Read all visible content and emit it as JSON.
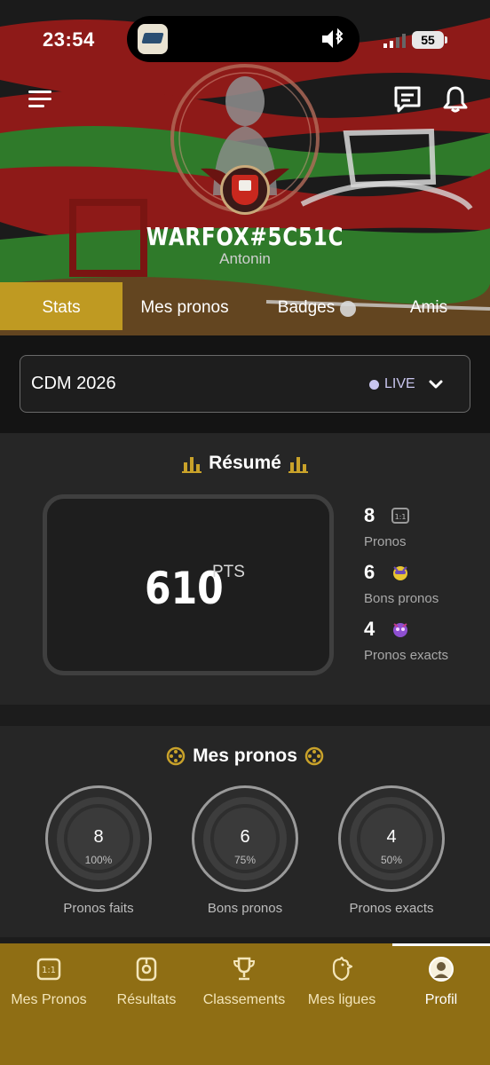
{
  "status_bar": {
    "time": "23:54",
    "battery": "55"
  },
  "profile": {
    "username": "WARFOX#5C51C",
    "real_name": "Antonin"
  },
  "tabs": [
    {
      "label": "Stats",
      "active": true
    },
    {
      "label": "Mes pronos",
      "active": false
    },
    {
      "label": "Badges",
      "active": false
    },
    {
      "label": "Amis",
      "active": false
    }
  ],
  "competition": {
    "name": "CDM 2026",
    "status": "LIVE"
  },
  "resume": {
    "title": "Résumé",
    "points": "610",
    "points_unit": "PTS",
    "stats": [
      {
        "value": "8",
        "label": "Pronos",
        "icon": "score-box-icon"
      },
      {
        "value": "6",
        "label": "Bons pronos",
        "icon": "mascot-yellow-icon"
      },
      {
        "value": "4",
        "label": "Pronos exacts",
        "icon": "mascot-purple-icon"
      }
    ]
  },
  "mes_pronos": {
    "title": "Mes pronos",
    "rings": [
      {
        "value": "8",
        "percent": "100%",
        "label": "Pronos faits"
      },
      {
        "value": "6",
        "percent": "75%",
        "label": "Bons pronos"
      },
      {
        "value": "4",
        "percent": "50%",
        "label": "Pronos exacts"
      }
    ]
  },
  "bottom_nav": [
    {
      "label": "Mes Pronos",
      "icon": "score-box-icon",
      "active": false
    },
    {
      "label": "Résultats",
      "icon": "whistle-icon",
      "active": false
    },
    {
      "label": "Classements",
      "icon": "trophy-icon",
      "active": false
    },
    {
      "label": "Mes ligues",
      "icon": "rooster-icon",
      "active": false
    },
    {
      "label": "Profil",
      "icon": "avatar-icon",
      "active": true
    }
  ],
  "colors": {
    "accent": "#bf9a22",
    "nav_bg": "#8f6e14",
    "banner_red": "#8e1a18",
    "banner_green": "#2f7a2a"
  }
}
